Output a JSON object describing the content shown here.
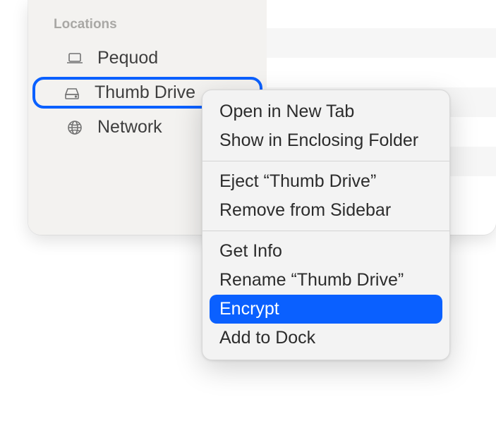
{
  "sidebar": {
    "section_header": "Locations",
    "items": [
      {
        "label": "Pequod"
      },
      {
        "label": "Thumb Drive"
      },
      {
        "label": "Network"
      }
    ]
  },
  "context_menu": {
    "items": [
      {
        "label": "Open in New Tab",
        "type": "item"
      },
      {
        "label": "Show in Enclosing Folder",
        "type": "item"
      },
      {
        "type": "separator"
      },
      {
        "label": "Eject “Thumb Drive”",
        "type": "item"
      },
      {
        "label": "Remove from Sidebar",
        "type": "item"
      },
      {
        "type": "separator"
      },
      {
        "label": "Get Info",
        "type": "item"
      },
      {
        "label": "Rename “Thumb Drive”",
        "type": "item"
      },
      {
        "label": "Encrypt",
        "type": "item",
        "highlighted": true
      },
      {
        "label": "Add to Dock",
        "type": "item"
      }
    ]
  },
  "colors": {
    "accent": "#0a60ff"
  }
}
